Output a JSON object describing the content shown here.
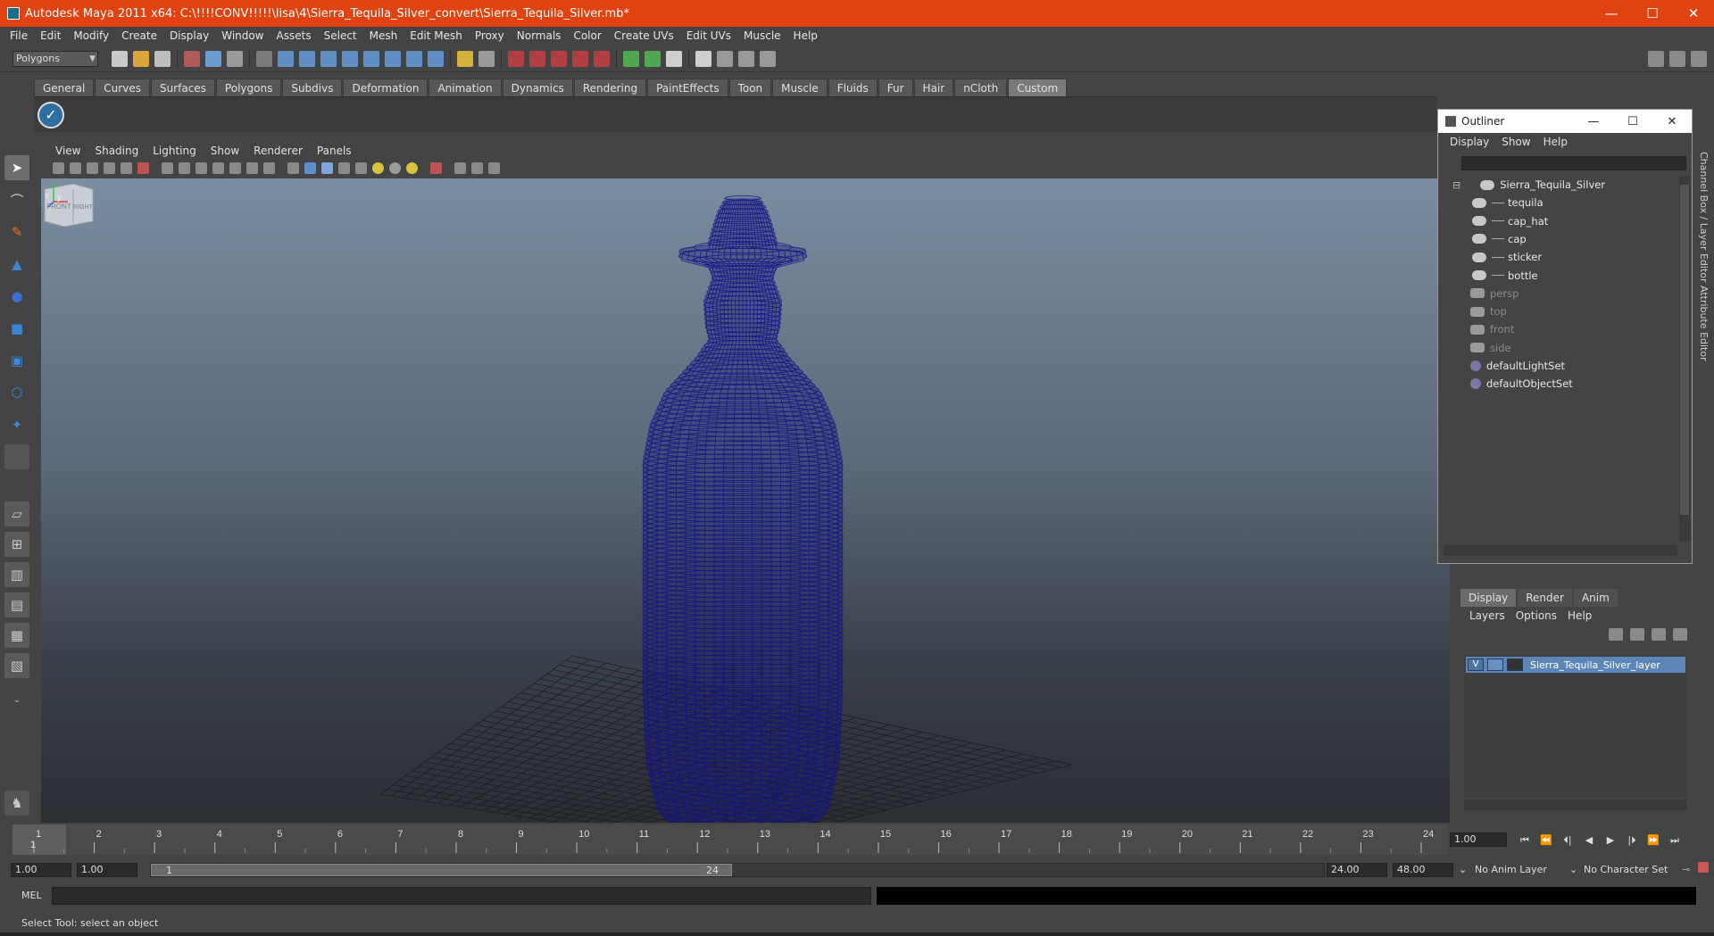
{
  "window": {
    "title": "Autodesk Maya 2011 x64: C:\\!!!!CONV!!!!!\\lisa\\4\\Sierra_Tequila_Silver_convert\\Sierra_Tequila_Silver.mb*",
    "minimize": "—",
    "maximize": "☐",
    "close": "✕"
  },
  "menubar": [
    "File",
    "Edit",
    "Modify",
    "Create",
    "Display",
    "Window",
    "Assets",
    "Select",
    "Mesh",
    "Edit Mesh",
    "Proxy",
    "Normals",
    "Color",
    "Create UVs",
    "Edit UVs",
    "Muscle",
    "Help"
  ],
  "statusline": {
    "mode": "Polygons"
  },
  "shelf_tabs": [
    "General",
    "Curves",
    "Surfaces",
    "Polygons",
    "Subdivs",
    "Deformation",
    "Animation",
    "Dynamics",
    "Rendering",
    "PaintEffects",
    "Toon",
    "Muscle",
    "Fluids",
    "Fur",
    "Hair",
    "nCloth",
    "Custom"
  ],
  "shelf_active_tab": "Custom",
  "panel_menu": [
    "View",
    "Shading",
    "Lighting",
    "Show",
    "Renderer",
    "Panels"
  ],
  "viewcube": {
    "front": "FRONT",
    "right": "RIGHT"
  },
  "axis": {
    "x": "x",
    "y": "y"
  },
  "outliner": {
    "title": "Outliner",
    "menu": [
      "Display",
      "Show",
      "Help"
    ],
    "items": [
      {
        "label": "Sierra_Tequila_Silver",
        "indent": 0,
        "kind": "group",
        "dim": false
      },
      {
        "label": "tequila",
        "indent": 1,
        "kind": "mesh",
        "dim": false
      },
      {
        "label": "cap_hat",
        "indent": 1,
        "kind": "mesh",
        "dim": false
      },
      {
        "label": "cap",
        "indent": 1,
        "kind": "mesh",
        "dim": false
      },
      {
        "label": "sticker",
        "indent": 1,
        "kind": "mesh",
        "dim": false
      },
      {
        "label": "bottle",
        "indent": 1,
        "kind": "mesh",
        "dim": false
      },
      {
        "label": "persp",
        "indent": 0,
        "kind": "camera",
        "dim": true
      },
      {
        "label": "top",
        "indent": 0,
        "kind": "camera",
        "dim": true
      },
      {
        "label": "front",
        "indent": 0,
        "kind": "camera",
        "dim": true
      },
      {
        "label": "side",
        "indent": 0,
        "kind": "camera",
        "dim": true
      },
      {
        "label": "defaultLightSet",
        "indent": 0,
        "kind": "set",
        "dim": false
      },
      {
        "label": "defaultObjectSet",
        "indent": 0,
        "kind": "set",
        "dim": false
      }
    ]
  },
  "right_strip": {
    "channel_box": "Channel Box / Layer Editor",
    "attribute_editor": "Attribute Editor"
  },
  "layer_editor": {
    "tabs": [
      "Display",
      "Render",
      "Anim"
    ],
    "active_tab": "Display",
    "menu": [
      "Layers",
      "Options",
      "Help"
    ],
    "layers": [
      {
        "visible": "V",
        "name": "Sierra_Tequila_Silver_layer"
      }
    ]
  },
  "timeline": {
    "ticks": [
      "1",
      "2",
      "3",
      "4",
      "5",
      "6",
      "7",
      "8",
      "9",
      "10",
      "11",
      "12",
      "13",
      "14",
      "15",
      "16",
      "17",
      "18",
      "19",
      "20",
      "21",
      "22",
      "23",
      "24"
    ],
    "current_marker": "1",
    "current_frame": "1.00",
    "playback": [
      "⏮",
      "⏪",
      "⏴|",
      "◀",
      "▶",
      "|⏵",
      "⏩",
      "⏭"
    ]
  },
  "range": {
    "start_time": "1.00",
    "playback_start": "1.00",
    "slider_start": "1",
    "slider_end": "24",
    "playback_end": "24.00",
    "end_time": "48.00",
    "anim_layer": "No Anim Layer",
    "character_set": "No Character Set"
  },
  "command_line": {
    "label": "MEL"
  },
  "help_line": {
    "text": "Select Tool: select an object"
  },
  "colors": {
    "titlebar": "#e0430f",
    "wireframe": "#14148c",
    "selection": "#5c86b8"
  }
}
